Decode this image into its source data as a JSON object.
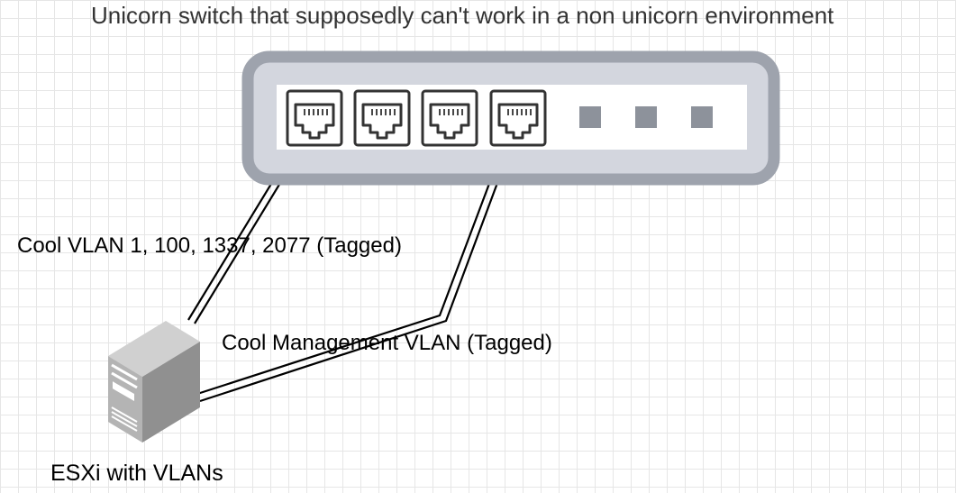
{
  "diagram": {
    "title": "Unicorn switch that supposedly can't work in a non unicorn environment",
    "links": [
      {
        "label": "Cool VLAN 1, 100, 1337, 2077 (Tagged)",
        "from": "esxi-server",
        "to": "switch-port-1"
      },
      {
        "label": "Cool Management VLAN (Tagged)",
        "from": "esxi-server",
        "to": "switch-port-4"
      }
    ],
    "server_label": "ESXi with VLANs",
    "switch": {
      "ethernet_ports": 4,
      "sfp_ports": 3
    }
  },
  "colors": {
    "switch_frame": "#9ea3ad",
    "switch_face": "#d3d6de",
    "port_stroke": "#333333",
    "sfp_port": "#8d929b",
    "cable": "#000000"
  }
}
